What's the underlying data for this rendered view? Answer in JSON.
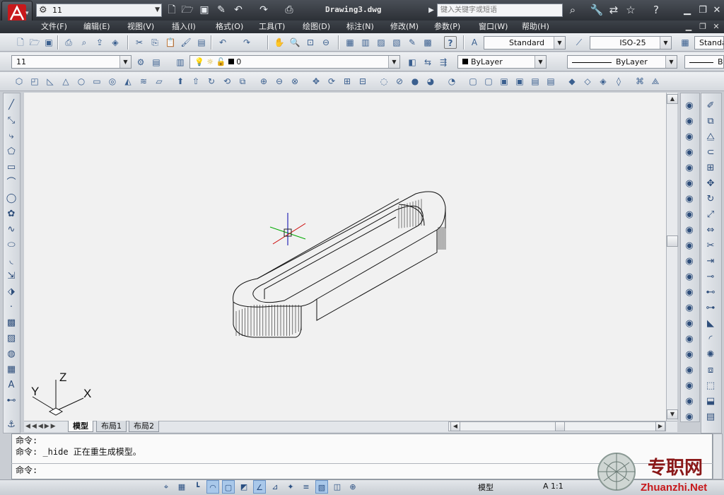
{
  "titlebar": {
    "workspace": "11",
    "document_title": "Drawing3.dwg",
    "search_placeholder": "键入关键字或短语"
  },
  "menus": [
    "文件(F)",
    "编辑(E)",
    "视图(V)",
    "插入(I)",
    "格式(O)",
    "工具(T)",
    "绘图(D)",
    "标注(N)",
    "修改(M)",
    "参数(P)",
    "窗口(W)",
    "帮助(H)"
  ],
  "styles": {
    "text_style": "Standard",
    "dim_style": "ISO-25",
    "table_style": "Standa"
  },
  "layers": {
    "current_layer_set": "11",
    "current_layer": "0",
    "color": "ByLayer",
    "linetype": "ByLayer",
    "lineweight": "B"
  },
  "ucs": {
    "x_label": "X",
    "y_label": "Y",
    "z_label": "Z"
  },
  "layout_tabs": [
    "模型",
    "布局1",
    "布局2"
  ],
  "command": {
    "history": [
      "命令:",
      "命令: _hide 正在重生成模型。"
    ],
    "prompt": "命令:"
  },
  "status": {
    "space": "模型",
    "annotation_scale": "A 1:1"
  },
  "watermark": {
    "text": "专职网",
    "url": "Zhuanzhi.Net"
  },
  "colors": {
    "title_bg": "#2c3036",
    "canvas_bg": "#f1f1f1",
    "toolbar_bg": "#e4e7eb",
    "accent_red": "#c8191c"
  }
}
